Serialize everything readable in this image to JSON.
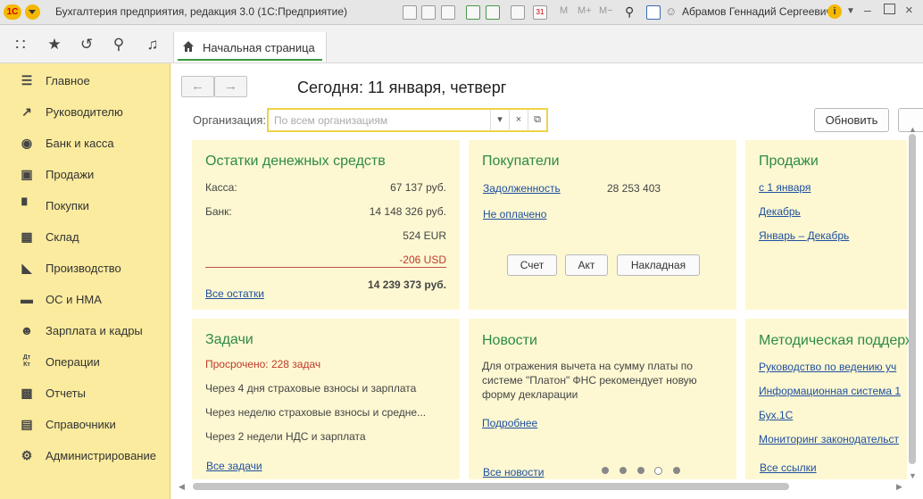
{
  "window": {
    "logo": "1С",
    "title": "Бухгалтерия предприятия, редакция 3.0  (1С:Предприятие)",
    "user": "Абрамов Геннадий Сергеевич",
    "toolbar_m": "M",
    "toolbar_mplus": "M+",
    "toolbar_mminus": "M−",
    "calendar_day": "31"
  },
  "tabs": [
    {
      "label": "Начальная страница"
    }
  ],
  "sidebar": {
    "items": [
      {
        "label": "Главное",
        "icon": "menu-icon"
      },
      {
        "label": "Руководителю",
        "icon": "trend-icon"
      },
      {
        "label": "Банк и касса",
        "icon": "coin-icon"
      },
      {
        "label": "Продажи",
        "icon": "bag-icon"
      },
      {
        "label": "Покупки",
        "icon": "cart-icon"
      },
      {
        "label": "Склад",
        "icon": "warehouse-icon"
      },
      {
        "label": "Производство",
        "icon": "factory-icon"
      },
      {
        "label": "ОС и НМА",
        "icon": "truck-icon"
      },
      {
        "label": "Зарплата и кадры",
        "icon": "people-icon"
      },
      {
        "label": "Операции",
        "icon": "debit-credit-icon"
      },
      {
        "label": "Отчеты",
        "icon": "chart-icon"
      },
      {
        "label": "Справочники",
        "icon": "book-icon"
      },
      {
        "label": "Администрирование",
        "icon": "gear-icon"
      }
    ]
  },
  "main": {
    "today": "Сегодня: 11 января, четверг",
    "org_label": "Организация:",
    "org_placeholder": "По всем организациям",
    "refresh_label": "Обновить"
  },
  "panels": {
    "cash": {
      "title": "Остатки денежных средств",
      "kassa_label": "Касса:",
      "kassa_value": "67 137 руб.",
      "bank_label": "Банк:",
      "bank_value": "14 148 326 руб.",
      "eur_value": "524 EUR",
      "usd_value": "-206 USD",
      "all_link": "Все остатки",
      "total": "14 239 373 руб."
    },
    "buyers": {
      "title": "Покупатели",
      "debt_link": "Задолженность",
      "debt_value": "28 253 403",
      "unpaid_link": "Не оплачено",
      "btn_invoice": "Счет",
      "btn_act": "Акт",
      "btn_waybill": "Накладная"
    },
    "sales": {
      "title": "Продажи",
      "links": [
        "с 1 января",
        "Декабрь",
        "Январь – Декабрь"
      ]
    },
    "tasks": {
      "title": "Задачи",
      "overdue": "Просрочено: 228 задач",
      "items": [
        "Через 4 дня страховые взносы и зарплата",
        "Через неделю страховые взносы и средне...",
        "Через 2 недели НДС и зарплата"
      ],
      "all_link": "Все задачи"
    },
    "news": {
      "title": "Новости",
      "text_lines": [
        "Для отражения вычета на сумму платы по",
        "системе \"Платон\" ФНС рекомендует новую",
        "форму декларации"
      ],
      "more_link": "Подробнее",
      "all_link": "Все новости"
    },
    "support": {
      "title": "Методическая поддерж",
      "links": [
        "Руководство по ведению уч",
        "Информационная система 1",
        "Бух.1С",
        "Мониторинг законодательст"
      ],
      "all_link": "Все ссылки"
    }
  },
  "colors": {
    "sidebar_bg": "#fbeb9e",
    "panel_bg": "#fdf8d2",
    "title_green": "#2e8a46",
    "link_blue": "#1f4fa0",
    "accent_yellow": "#f5b800",
    "negative_red": "#c0392b"
  }
}
